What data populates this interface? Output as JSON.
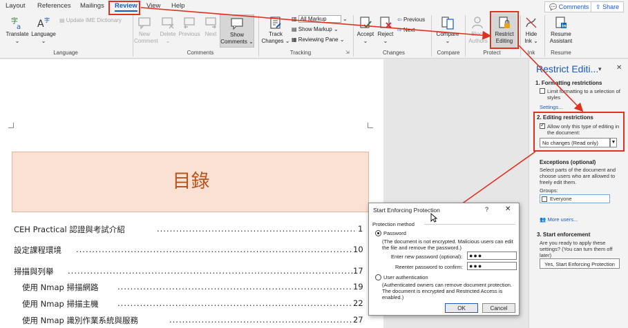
{
  "tabs": [
    "Layout",
    "References",
    "Mailings",
    "Review",
    "View",
    "Help"
  ],
  "top_buttons": {
    "comments": "Comments",
    "share": "Share"
  },
  "ribbon": {
    "language": {
      "translate": "Translate",
      "language": "Language",
      "update_ime": "Update IME Dictionary",
      "label": "Language"
    },
    "comments": {
      "new": "New Comment",
      "delete": "Delete",
      "previous": "Previous",
      "next": "Next",
      "show": "Show Comments",
      "label": "Comments"
    },
    "tracking": {
      "track": "Track Changes",
      "markup_select": "All Markup",
      "show_markup": "Show Markup",
      "reviewing_pane": "Reviewing Pane",
      "label": "Tracking"
    },
    "changes": {
      "accept": "Accept",
      "reject": "Reject",
      "previous": "Previous",
      "next": "Next",
      "label": "Changes"
    },
    "compare": {
      "compare": "Compare",
      "label": "Compare"
    },
    "protect": {
      "block_authors": "Block Authors",
      "restrict_editing": "Restrict Editing",
      "label": "Protect"
    },
    "ink": {
      "hide_ink": "Hide Ink",
      "label": "Ink"
    },
    "resume": {
      "assistant": "Resume Assistant",
      "label": "Resume"
    }
  },
  "document": {
    "toc_title": "目錄",
    "toc": [
      {
        "text": "CEH Practical 認證與考試介紹",
        "page": "1"
      },
      {
        "text": "設定課程環境",
        "page": "10"
      },
      {
        "text": "掃描與列舉",
        "page": "17"
      },
      {
        "text": "使用 Nmap 掃描網路",
        "page": "19"
      },
      {
        "text": "使用 Nmap 掃描主機",
        "page": "22"
      },
      {
        "text": "使用 Nmap 識別作業系統與服務",
        "page": "27"
      }
    ]
  },
  "pane": {
    "title": "Restrict Editi...",
    "s1_heading": "1. Formatting restrictions",
    "s1_check": "Limit formatting to a selection of styles",
    "s1_link": "Settings...",
    "s2_heading": "2. Editing restrictions",
    "s2_check": "Allow only this type of editing in the document:",
    "s2_select": "No changes (Read only)",
    "exceptions_heading": "Exceptions (optional)",
    "exceptions_text": "Select parts of the document and choose users who are allowed to freely edit them.",
    "groups_label": "Groups:",
    "group_everyone": "Everyone",
    "more_users": "More users...",
    "s3_heading": "3. Start enforcement",
    "s3_text": "Are you ready to apply these settings? (You can turn them off later)",
    "s3_button": "Yes, Start Enforcing Protection"
  },
  "dialog": {
    "title": "Start Enforcing Protection",
    "help": "?",
    "close": "✕",
    "method_label": "Protection method",
    "password_option": "Password",
    "password_note": "(The document is not encrypted. Malicious users can edit the file and remove the password.)",
    "new_password_label": "Enter new password (optional):",
    "new_password_value": "●●●",
    "reenter_label": "Reenter password to confirm:",
    "reenter_value": "●●●",
    "user_auth_option": "User authentication",
    "user_auth_note": "(Authenticated owners can remove document protection. The document is encrypted and Restricted Access is enabled.)",
    "ok": "OK",
    "cancel": "Cancel"
  }
}
